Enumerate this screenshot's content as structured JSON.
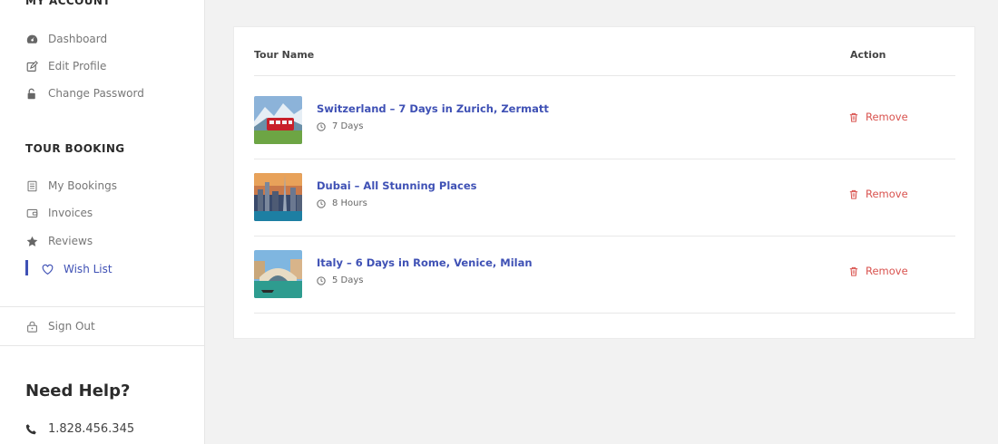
{
  "sidebar": {
    "account_title": "MY ACCOUNT",
    "account_items": [
      {
        "label": "Dashboard",
        "icon": "dashboard-icon"
      },
      {
        "label": "Edit Profile",
        "icon": "edit-icon"
      },
      {
        "label": "Change Password",
        "icon": "unlock-icon"
      }
    ],
    "booking_title": "TOUR BOOKING",
    "booking_items": [
      {
        "label": "My Bookings",
        "icon": "document-icon"
      },
      {
        "label": "Invoices",
        "icon": "wallet-icon"
      },
      {
        "label": "Reviews",
        "icon": "star-icon"
      },
      {
        "label": "Wish List",
        "icon": "heart-icon",
        "active": true
      }
    ],
    "signout_label": "Sign Out",
    "help_title": "Need Help?",
    "phone": "1.828.456.345"
  },
  "table": {
    "col_name": "Tour Name",
    "col_action": "Action",
    "rows": [
      {
        "title": "Switzerland – 7 Days in Zurich, Zermatt",
        "duration": "7 Days",
        "action": "Remove"
      },
      {
        "title": "Dubai – All Stunning Places",
        "duration": "8 Hours",
        "action": "Remove"
      },
      {
        "title": "Italy – 6 Days in Rome, Venice, Milan",
        "duration": "5 Days",
        "action": "Remove"
      }
    ]
  },
  "colors": {
    "accent": "#3f51b5",
    "danger": "#d9534f"
  }
}
